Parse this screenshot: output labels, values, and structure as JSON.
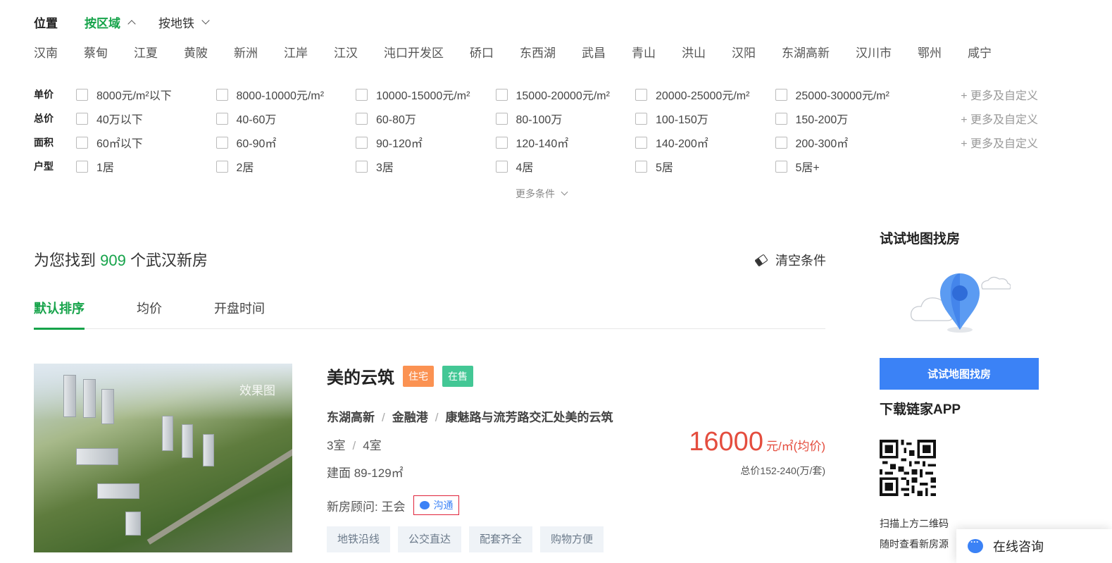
{
  "location": {
    "label": "位置",
    "tabs": [
      {
        "label": "按区域"
      },
      {
        "label": "按地铁"
      }
    ],
    "districts": [
      "汉南",
      "蔡甸",
      "江夏",
      "黄陂",
      "新洲",
      "江岸",
      "江汉",
      "沌口开发区",
      "硚口",
      "东西湖",
      "武昌",
      "青山",
      "洪山",
      "汉阳",
      "东湖高新",
      "汉川市",
      "鄂州",
      "咸宁"
    ]
  },
  "filters": [
    {
      "label": "单价",
      "options": [
        "8000元/m²以下",
        "8000-10000元/m²",
        "10000-15000元/m²",
        "15000-20000元/m²",
        "20000-25000元/m²",
        "25000-30000元/m²"
      ],
      "more": "+ 更多及自定义"
    },
    {
      "label": "总价",
      "options": [
        "40万以下",
        "40-60万",
        "60-80万",
        "80-100万",
        "100-150万",
        "150-200万"
      ],
      "more": "+ 更多及自定义"
    },
    {
      "label": "面积",
      "options": [
        "60㎡以下",
        "60-90㎡",
        "90-120㎡",
        "120-140㎡",
        "140-200㎡",
        "200-300㎡"
      ],
      "more": "+ 更多及自定义"
    },
    {
      "label": "户型",
      "options": [
        "1居",
        "2居",
        "3居",
        "4居",
        "5居",
        "5居+"
      ],
      "more": ""
    }
  ],
  "more_conditions": "更多条件",
  "results": {
    "prefix": "为您找到",
    "count": "909",
    "suffix": "个武汉新房",
    "clear": "清空条件"
  },
  "sort_tabs": [
    "默认排序",
    "均价",
    "开盘时间"
  ],
  "listing": {
    "watermark": "效果图",
    "name": "美的云筑",
    "tags": [
      "住宅",
      "在售"
    ],
    "district": "东湖高新",
    "area": "金融港",
    "address": "康魅路与流芳路交汇处美的云筑",
    "rooms": [
      "3室",
      "4室"
    ],
    "build_area": "建面 89-129㎡",
    "advisor_label": "新房顾问:",
    "advisor_name": "王会",
    "chat_label": "沟通",
    "features": [
      "地铁沿线",
      "公交直达",
      "配套齐全",
      "购物方便"
    ],
    "price": "16000",
    "price_unit": "元/㎡(均价)",
    "total_price": "总价152-240(万/套)"
  },
  "sidebar": {
    "map_title": "试试地图找房",
    "map_button": "试试地图找房",
    "app_title": "下载链家APP",
    "scan_line1": "扫描上方二维码",
    "scan_line2": "随时查看新房源"
  },
  "consult": "在线咨询"
}
